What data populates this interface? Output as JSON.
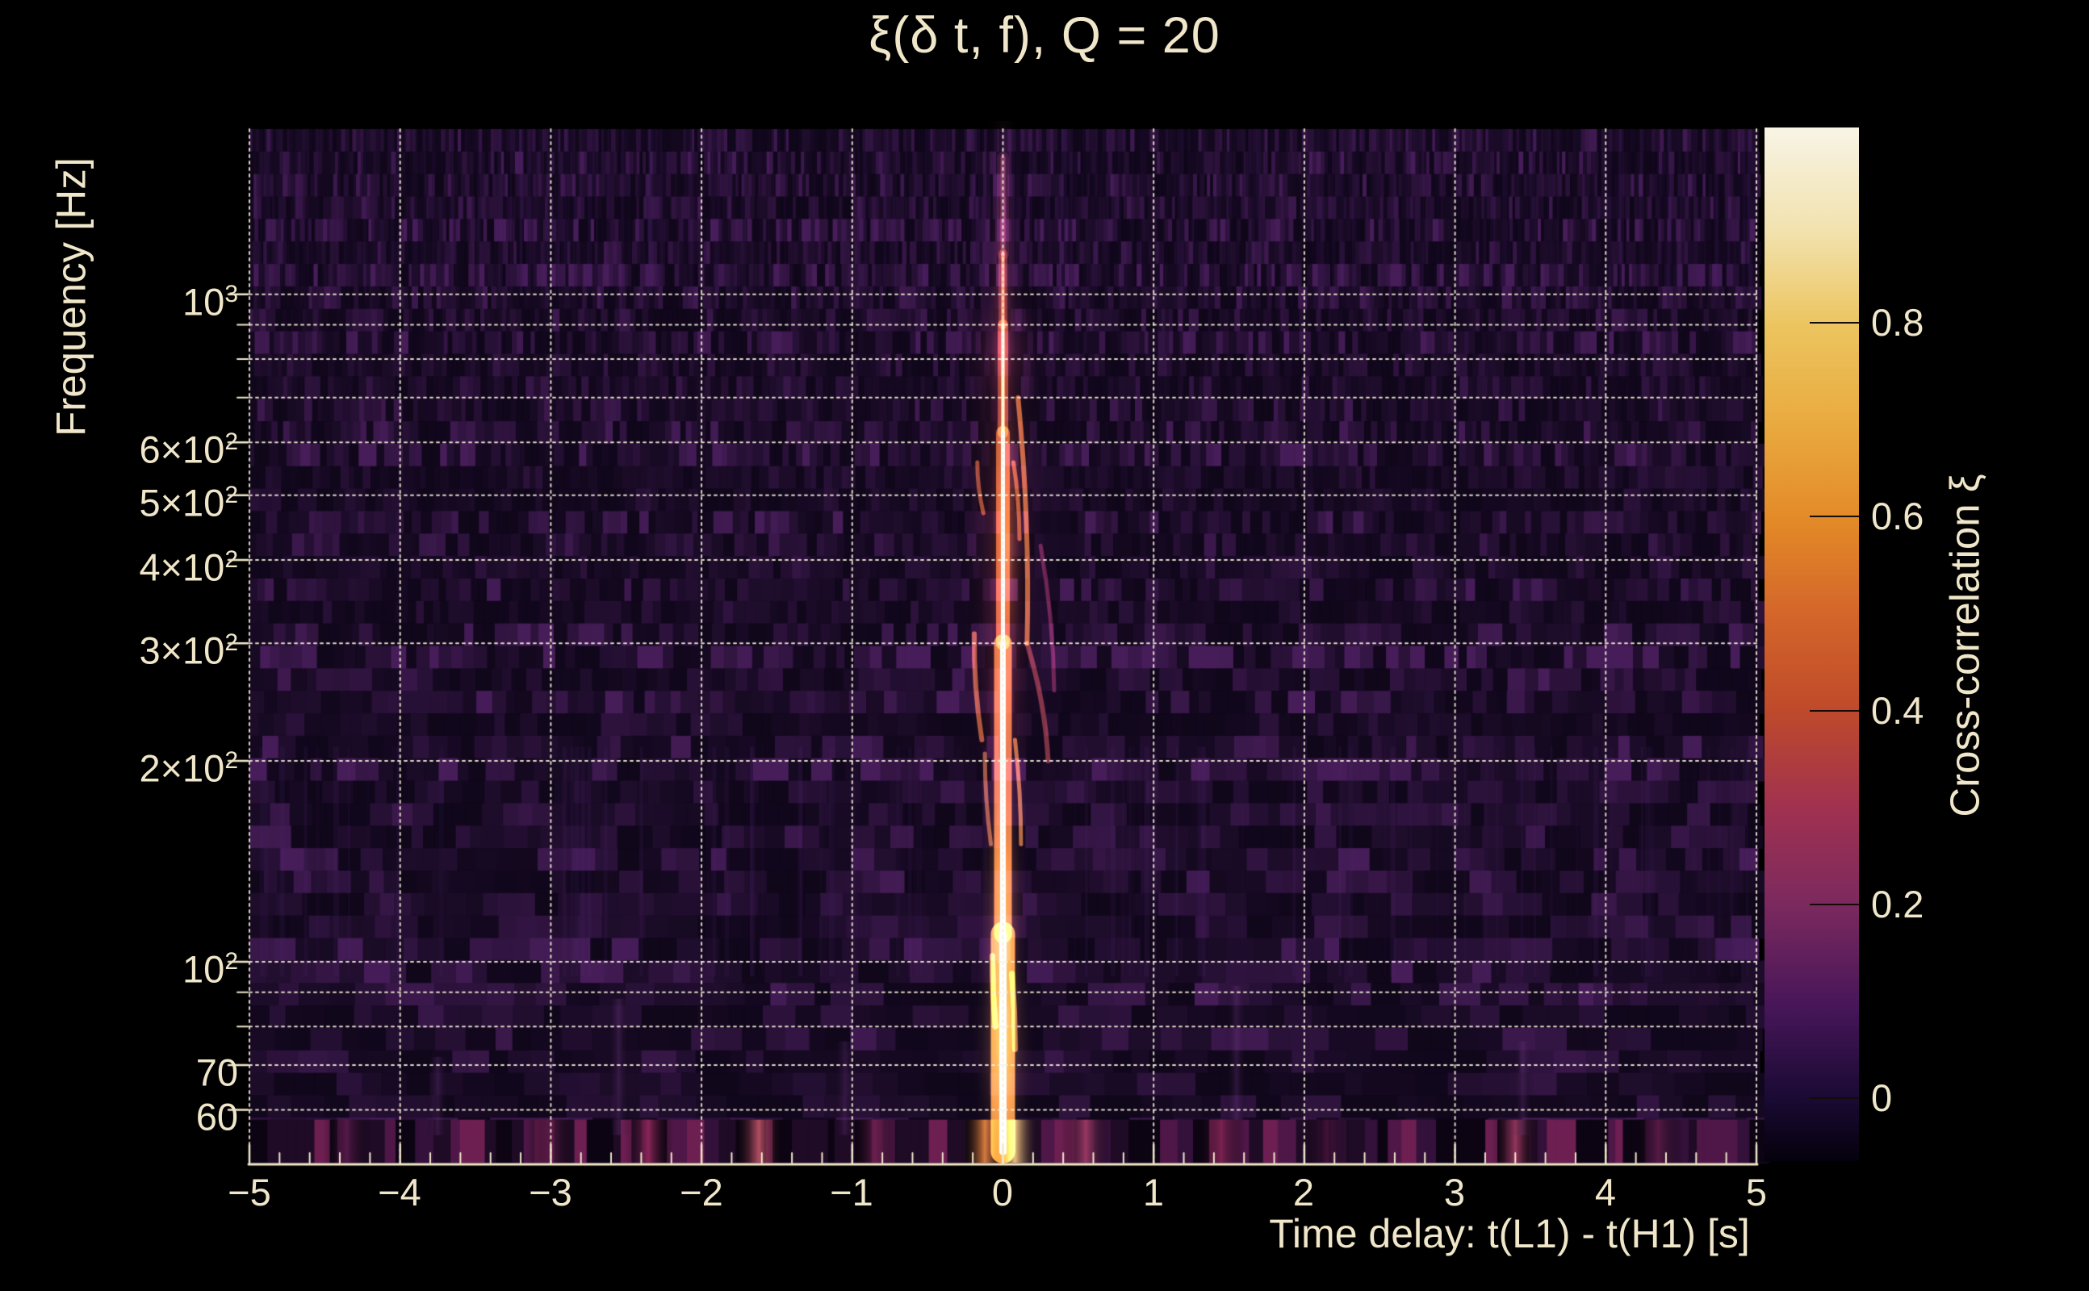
{
  "ui": {
    "text_color": "#f0e6c9",
    "background_color": "#000000",
    "grid_color": "rgba(247,240,219,0.9)",
    "axis_color": "#f2e8cc"
  },
  "title": {
    "text": "ξ(δ t, f), Q = 20"
  },
  "axes": {
    "x": {
      "label": "Time delay: t(L1) - t(H1) [s]",
      "minor_step": 0.2,
      "ticks": [
        {
          "v": -5,
          "label": "−5"
        },
        {
          "v": -4,
          "label": "−4"
        },
        {
          "v": -3,
          "label": "−3"
        },
        {
          "v": -2,
          "label": "−2"
        },
        {
          "v": -1,
          "label": "−1"
        },
        {
          "v": 0,
          "label": "0"
        },
        {
          "v": 1,
          "label": "1"
        },
        {
          "v": 2,
          "label": "2"
        },
        {
          "v": 3,
          "label": "3"
        },
        {
          "v": 4,
          "label": "4"
        },
        {
          "v": 5,
          "label": "5"
        }
      ]
    },
    "y": {
      "label": "Frequency [Hz]",
      "scale": "log",
      "range_hz": [
        50,
        1768
      ],
      "ticks": [
        {
          "v": 1000,
          "m": "10",
          "e": "3"
        },
        {
          "v": 600,
          "m": "6×10",
          "e": "2"
        },
        {
          "v": 500,
          "m": "5×10",
          "e": "2"
        },
        {
          "v": 400,
          "m": "4×10",
          "e": "2"
        },
        {
          "v": 300,
          "m": "3×10",
          "e": "2"
        },
        {
          "v": 200,
          "m": "2×10",
          "e": "2"
        },
        {
          "v": 100,
          "m": "10",
          "e": "2"
        },
        {
          "v": 70,
          "m": "70",
          "e": ""
        },
        {
          "v": 60,
          "m": "60",
          "e": ""
        }
      ],
      "minor_tick_hz": [
        900,
        800,
        700,
        90,
        80
      ]
    }
  },
  "colorbar": {
    "label": "Cross-correlation ξ",
    "vmin": -0.07,
    "vmax": 1.0,
    "ticks": [
      {
        "v": 0.8,
        "label": "0.8"
      },
      {
        "v": 0.6,
        "label": "0.6"
      },
      {
        "v": 0.4,
        "label": "0.4"
      },
      {
        "v": 0.2,
        "label": "0.2"
      },
      {
        "v": 0.0,
        "label": "0"
      }
    ],
    "gradient": [
      {
        "pos": 0,
        "color": "#f8f4e6"
      },
      {
        "pos": 10,
        "color": "#f2e2ae"
      },
      {
        "pos": 19,
        "color": "#ecc560"
      },
      {
        "pos": 29,
        "color": "#e9a93e"
      },
      {
        "pos": 38,
        "color": "#e38a28"
      },
      {
        "pos": 47,
        "color": "#d4662a"
      },
      {
        "pos": 56,
        "color": "#bf4b2a"
      },
      {
        "pos": 66,
        "color": "#a03150"
      },
      {
        "pos": 75,
        "color": "#7c2a5e"
      },
      {
        "pos": 85,
        "color": "#471659"
      },
      {
        "pos": 94,
        "color": "#190a33"
      },
      {
        "pos": 100,
        "color": "#05010c"
      }
    ]
  },
  "chart_data": {
    "type": "heatmap",
    "title": "ξ(δ t, f), Q = 20",
    "xlabel": "Time delay: t(L1) - t(H1) [s]",
    "ylabel": "Frequency [Hz]",
    "value_label": "Cross-correlation ξ",
    "x_range": [
      -5,
      5
    ],
    "y_range_hz": [
      50,
      1768
    ],
    "y_scale": "log",
    "colormap": "inferno",
    "value_range": [
      -0.07,
      1.0
    ],
    "legend_position": "right-colorbar",
    "grid": {
      "x_major": [
        -5,
        -4,
        -3,
        -2,
        -1,
        0,
        1,
        2,
        3,
        4,
        5
      ],
      "y_lines_hz": [
        60,
        70,
        80,
        90,
        100,
        200,
        300,
        400,
        500,
        600,
        700,
        800,
        900,
        1000
      ],
      "style": "dotted"
    },
    "peak": {
      "time_delay_s": 0.0,
      "freq_span_hz": [
        50,
        1500
      ],
      "brightest_freq_hz": [
        60,
        180
      ],
      "max_xi": 1.0
    },
    "render": {
      "base": {
        "r": 16,
        "g": 7,
        "b": 27,
        "dr": 44,
        "dg": 18,
        "db": 50
      },
      "bands": [
        {
          "f1": 1050,
          "f2": 1768,
          "m": 1.3
        },
        {
          "f1": 700,
          "f2": 1000,
          "m": 1.15
        },
        {
          "f1": 240,
          "f2": 290,
          "m": 1.45
        },
        {
          "f1": 125,
          "f2": 205,
          "m": 1.3
        },
        {
          "f1": 88,
          "f2": 112,
          "m": 1.2
        },
        {
          "f1": 460,
          "f2": 560,
          "m": 0.8
        },
        {
          "f1": 55,
          "f2": 66,
          "m": 1.1
        }
      ],
      "streak_regions": [
        {
          "f1": 1000,
          "f2": 1768,
          "count": 150,
          "color": "70,35,105"
        },
        {
          "f1": 95,
          "f2": 210,
          "count": 90,
          "color": "80,40,110"
        }
      ],
      "glows": [
        {
          "t": 0.0,
          "f": 460,
          "rt": 0.3,
          "fs": 0.55,
          "color": "rgba(214,80,34,0.22)"
        },
        {
          "t": 0.03,
          "f": 430,
          "rt": 0.13,
          "fs": 0.3,
          "color": "rgba(235,120,40,0.40)"
        },
        {
          "t": 0.0,
          "f": 250,
          "rt": 0.2,
          "fs": 0.32,
          "color": "rgba(190,60,60,0.28)"
        },
        {
          "t": 0.0,
          "f": 120,
          "rt": 0.17,
          "fs": 0.28,
          "color": "rgba(250,160,60,0.50)"
        },
        {
          "t": 0.0,
          "f": 75,
          "rt": 0.22,
          "fs": 0.22,
          "color": "rgba(248,168,82,0.45)"
        },
        {
          "t": 0.0,
          "f": 900,
          "rt": 0.11,
          "fs": 0.26,
          "color": "rgba(190,70,50,0.30)"
        },
        {
          "t": 0.0,
          "f": 1300,
          "rt": 0.13,
          "fs": 0.32,
          "color": "rgba(120,50,95,0.25)"
        },
        {
          "t": 0.0,
          "f": 820,
          "rt": 0.35,
          "fs": 0.1,
          "color": "rgba(140,48,92,0.30)"
        }
      ],
      "needle": [
        {
          "t": 0,
          "f1": 52,
          "f2": 110,
          "w": 9,
          "core": "rgba(255,249,228,0.98)",
          "gw": 30,
          "glow": "rgba(252,166,54,0.80)"
        },
        {
          "t": 0,
          "f1": 110,
          "f2": 300,
          "w": 7,
          "core": "rgba(255,241,206,0.95)",
          "gw": 22,
          "glow": "rgba(250,145,48,0.70)"
        },
        {
          "t": 0,
          "f1": 300,
          "f2": 620,
          "w": 5,
          "core": "rgba(255,236,196,0.92)",
          "gw": 17,
          "glow": "rgba(246,128,44,0.60)"
        },
        {
          "t": 0,
          "f1": 620,
          "f2": 900,
          "w": 4,
          "core": "rgba(255,212,152,0.82)",
          "gw": 13,
          "glow": "rgba(226,106,40,0.50)"
        },
        {
          "t": 0,
          "f1": 900,
          "f2": 1150,
          "w": 4,
          "core": "rgba(250,172,92,0.55)",
          "gw": 11,
          "glow": "rgba(196,88,42,0.35)"
        },
        {
          "t": 0,
          "f1": 1150,
          "f2": 1600,
          "w": 6,
          "core": "rgba(188,92,84,0.28)",
          "gw": 15,
          "glow": "rgba(128,50,82,0.22)"
        }
      ],
      "arcs": [
        {
          "t1": 0.1,
          "f1": 700,
          "t2": 0.16,
          "f2": 300,
          "bend": 0.05,
          "w": 6,
          "color": "rgba(240,130,50,0.70)"
        },
        {
          "t1": 0.16,
          "f1": 300,
          "t2": 0.3,
          "f2": 200,
          "bend": 0.05,
          "w": 6,
          "color": "rgba(200,80,70,0.55)"
        },
        {
          "t1": 0.25,
          "f1": 420,
          "t2": 0.34,
          "f2": 255,
          "bend": 0.04,
          "w": 5,
          "color": "rgba(165,52,92,0.50)"
        },
        {
          "t1": 0.07,
          "f1": 560,
          "t2": 0.11,
          "f2": 430,
          "bend": 0.02,
          "w": 5,
          "color": "rgba(235,120,46,0.60)"
        },
        {
          "t1": -0.17,
          "f1": 560,
          "t2": -0.13,
          "f2": 470,
          "bend": -0.02,
          "w": 5,
          "color": "rgba(230,110,45,0.60)"
        },
        {
          "t1": -0.19,
          "f1": 310,
          "t2": -0.14,
          "f2": 215,
          "bend": -0.03,
          "w": 6,
          "color": "rgba(235,120,50,0.65)"
        },
        {
          "t1": -0.12,
          "f1": 205,
          "t2": -0.08,
          "f2": 150,
          "bend": -0.02,
          "w": 5,
          "color": "rgba(240,140,60,0.55)"
        },
        {
          "t1": 0.08,
          "f1": 215,
          "t2": 0.12,
          "f2": 150,
          "bend": 0.02,
          "w": 5,
          "color": "rgba(245,150,60,0.65)"
        },
        {
          "t1": -0.07,
          "f1": 102,
          "t2": -0.05,
          "f2": 80,
          "bend": -0.01,
          "w": 7,
          "color": "rgba(250,170,80,0.55)"
        },
        {
          "t1": 0.06,
          "f1": 96,
          "t2": 0.08,
          "f2": 74,
          "bend": 0.01,
          "w": 7,
          "color": "rgba(250,160,70,0.60)"
        }
      ],
      "bottom_blobs": [
        {
          "t": -4.35,
          "color": "rgba(85,25,74,0.85)"
        },
        {
          "t": -3.0,
          "color": "rgba(90,26,72,0.85)"
        },
        {
          "t": -2.35,
          "color": "rgba(147,41,94,0.90)"
        },
        {
          "t": -1.62,
          "color": "rgba(194,86,104,0.90)"
        },
        {
          "t": -0.85,
          "color": "rgba(106,32,80,0.85)"
        },
        {
          "t": -0.12,
          "color": "rgba(224,129,63,0.95)"
        },
        {
          "t": 0.08,
          "color": "rgba(245,198,133,0.95)"
        },
        {
          "t": 0.55,
          "color": "rgba(164,62,104,0.85)"
        },
        {
          "t": 1.45,
          "color": "rgba(124,34,80,0.85)"
        },
        {
          "t": 2.15,
          "color": "rgba(74,21,64,0.85)"
        },
        {
          "t": 3.4,
          "color": "rgba(160,58,98,0.90)"
        },
        {
          "t": 4.35,
          "color": "rgba(94,28,72,0.85)"
        }
      ],
      "smudges": [
        {
          "t": -3.75,
          "f1": 55,
          "f2": 72,
          "color": "rgba(120,60,140,0.28)"
        },
        {
          "t": -2.55,
          "f1": 55,
          "f2": 88,
          "color": "rgba(120,60,140,0.30)"
        },
        {
          "t": -1.05,
          "f1": 55,
          "f2": 76,
          "color": "rgba(120,60,140,0.26)"
        },
        {
          "t": 1.55,
          "f1": 58,
          "f2": 92,
          "color": "rgba(120,60,140,0.30)"
        },
        {
          "t": 3.45,
          "f1": 55,
          "f2": 76,
          "color": "rgba(120,60,140,0.26)"
        }
      ]
    }
  }
}
